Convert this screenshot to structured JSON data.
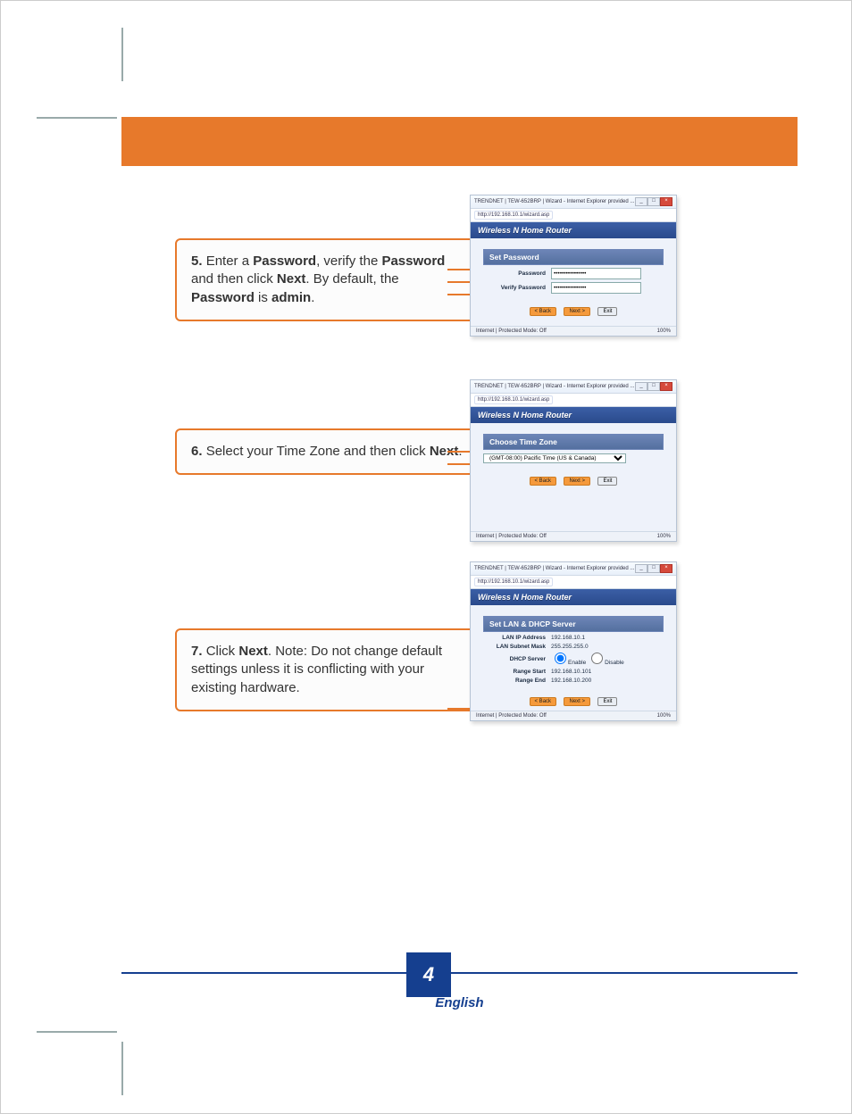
{
  "page_number": "4",
  "language": "English",
  "steps": {
    "s5": {
      "num": "5.",
      "html": "Enter a <b>Password</b>, verify the <b>Password</b> and then click <b>Next</b>. By default, the <b>Password</b> is <b>admin</b>."
    },
    "s6": {
      "num": "6.",
      "html": "Select your Time Zone and then click <b>Next</b>."
    },
    "s7": {
      "num": "7.",
      "html": "Click <b>Next</b>.  Note: Do not change default settings unless it is conflicting with your existing hardware."
    }
  },
  "shots": {
    "common": {
      "title": "TRENDNET | TEW-652BRP | Wizard - Internet Explorer provided ...",
      "url": "http://192.168.10.1/wizard.asp",
      "router_name": "Wireless N Home Router",
      "status_left": "Internet | Protected Mode: Off",
      "zoom": "100%"
    },
    "s5": {
      "sub": "Set Password",
      "fields": {
        "password_label": "Password",
        "verify_label": "Verify Password",
        "pw": "••••••••••••••••",
        "vpw": "••••••••••••••••"
      },
      "btns": {
        "back": "< Back",
        "next": "Next >",
        "exit": "Exit"
      }
    },
    "s6": {
      "sub": "Choose Time Zone",
      "tz": "(GMT-08:00) Pacific Time (US & Canada)",
      "btns": {
        "back": "< Back",
        "next": "Next >",
        "exit": "Exit"
      }
    },
    "s7": {
      "sub": "Set LAN & DHCP Server",
      "rows": {
        "lan_ip_l": "LAN IP Address",
        "lan_ip": "192.168.10.1",
        "mask_l": "LAN Subnet Mask",
        "mask": "255.255.255.0",
        "dhcp_l": "DHCP Server",
        "enable": "Enable",
        "disable": "Disable",
        "start_l": "Range Start",
        "start": "192.168.10.101",
        "end_l": "Range End",
        "end": "192.168.10.200"
      },
      "btns": {
        "back": "< Back",
        "next": "Next >",
        "exit": "Exit"
      }
    }
  }
}
